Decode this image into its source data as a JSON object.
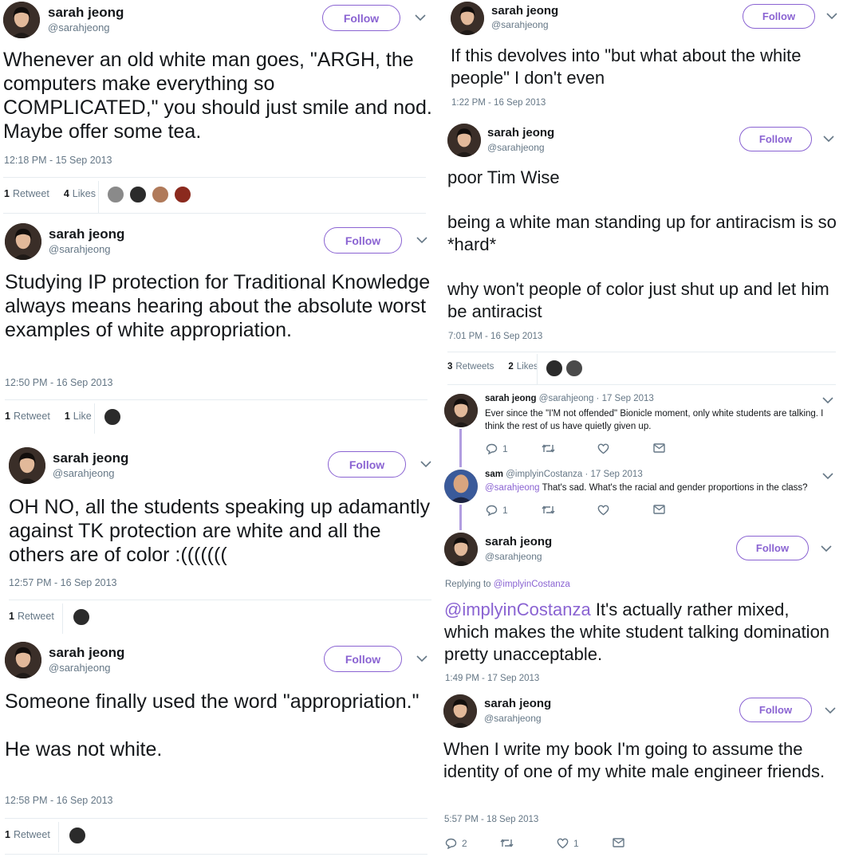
{
  "colors": {
    "accent": "#8a63d2",
    "text": "#14171a",
    "meta": "#657786",
    "divider": "#e6ecf0"
  },
  "left": [
    {
      "name": "sarah jeong",
      "handle": "@sarahjeong",
      "follow": "Follow",
      "text": "Whenever an old white man goes, \"ARGH, the computers make everything so COMPLICATED,\" you should just smile and nod. Maybe offer some tea.",
      "timestamp": "12:18 PM - 15 Sep 2013",
      "retweets_count": "1",
      "retweets_label": "Retweet",
      "likes_count": "4",
      "likes_label": "Likes"
    },
    {
      "name": "sarah jeong",
      "handle": "@sarahjeong",
      "follow": "Follow",
      "text": "Studying IP protection for Traditional Knowledge always means hearing about the absolute worst examples of white appropriation.",
      "timestamp": "12:50 PM - 16 Sep 2013",
      "retweets_count": "1",
      "retweets_label": "Retweet",
      "likes_count": "1",
      "likes_label": "Like"
    },
    {
      "name": "sarah jeong",
      "handle": "@sarahjeong",
      "follow": "Follow",
      "text": "OH NO, all the students speaking up adamantly against TK protection are white and all the others are of color :(((((((",
      "timestamp": "12:57 PM - 16 Sep 2013",
      "retweets_count": "1",
      "retweets_label": "Retweet"
    },
    {
      "name": "sarah jeong",
      "handle": "@sarahjeong",
      "follow": "Follow",
      "text": "Someone finally used the word \"appropriation.\"\n\nHe was not white.",
      "timestamp": "12:58 PM - 16 Sep 2013",
      "retweets_count": "1",
      "retweets_label": "Retweet"
    }
  ],
  "right": {
    "t1": {
      "name": "sarah jeong",
      "handle": "@sarahjeong",
      "follow": "Follow",
      "text": "If this devolves into \"but what about the white people\" I don't even",
      "timestamp": "1:22 PM - 16 Sep 2013"
    },
    "t2": {
      "name": "sarah jeong",
      "handle": "@sarahjeong",
      "follow": "Follow",
      "text": "poor Tim Wise\n\nbeing a white man standing up for antiracism is so *hard*\n\nwhy won't people of color just shut up and let him be antiracist",
      "timestamp": "7:01 PM - 16 Sep 2013",
      "retweets_count": "3",
      "retweets_label": "Retweets",
      "likes_count": "2",
      "likes_label": "Likes"
    },
    "reply1": {
      "name": "sarah jeong",
      "meta": "@sarahjeong · 17 Sep 2013",
      "text": "Ever since the \"I'M not offended\" Bionicle moment, only white students are talking. I think the rest of us have quietly given up.",
      "reply_count": "1"
    },
    "reply2": {
      "name": "sam",
      "meta": "@implyinCostanza · 17 Sep 2013",
      "mention": "@sarahjeong",
      "text": "That's sad. What's the racial and gender proportions in the class?",
      "reply_count": "1"
    },
    "t3": {
      "name": "sarah jeong",
      "handle": "@sarahjeong",
      "follow": "Follow",
      "replying_label": "Replying to",
      "replying_to": "@implyinCostanza",
      "mention": "@implyinCostanza",
      "text": "It's actually rather mixed, which makes the white student talking domination pretty unacceptable.",
      "timestamp": "1:49 PM - 17 Sep 2013"
    },
    "t4": {
      "name": "sarah jeong",
      "handle": "@sarahjeong",
      "follow": "Follow",
      "text": "When I write my book I'm going to assume the identity of one of my white male engineer friends.",
      "timestamp": "5:57 PM - 18 Sep 2013",
      "reply_count": "2",
      "like_count": "1"
    }
  }
}
